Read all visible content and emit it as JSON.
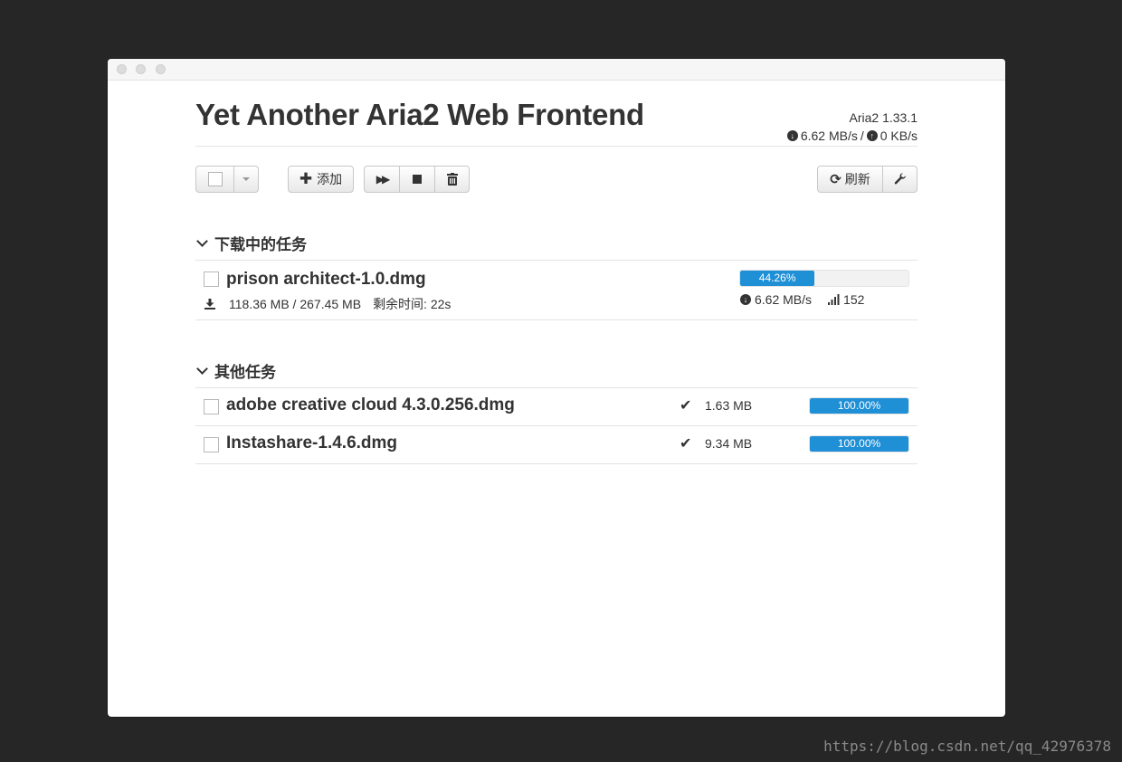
{
  "header": {
    "title": "Yet Another Aria2 Web Frontend",
    "version": "Aria2 1.33.1",
    "download_speed": "6.62 MB/s",
    "separator": "/",
    "upload_speed": "0 KB/s"
  },
  "toolbar": {
    "add_label": "添加",
    "refresh_label": "刷新"
  },
  "sections": {
    "active": {
      "title": "下载中的任务",
      "tasks": [
        {
          "name": "prison architect-1.0.dmg",
          "size": "118.36 MB / 267.45 MB",
          "remaining": "剩余时间: 22s",
          "progress": 0.4426,
          "progress_label": "44.26%",
          "speed": "6.62 MB/s",
          "connections": "152"
        }
      ]
    },
    "other": {
      "title": "其他任务",
      "tasks": [
        {
          "name": "adobe creative cloud 4.3.0.256.dmg",
          "size": "1.63 MB",
          "progress": 1.0,
          "progress_label": "100.00%"
        },
        {
          "name": "Instashare-1.4.6.dmg",
          "size": "9.34 MB",
          "progress": 1.0,
          "progress_label": "100.00%"
        }
      ]
    }
  },
  "colors": {
    "progress": "#1f8fd6",
    "background": "#262626"
  },
  "watermark": "https://blog.csdn.net/qq_42976378"
}
